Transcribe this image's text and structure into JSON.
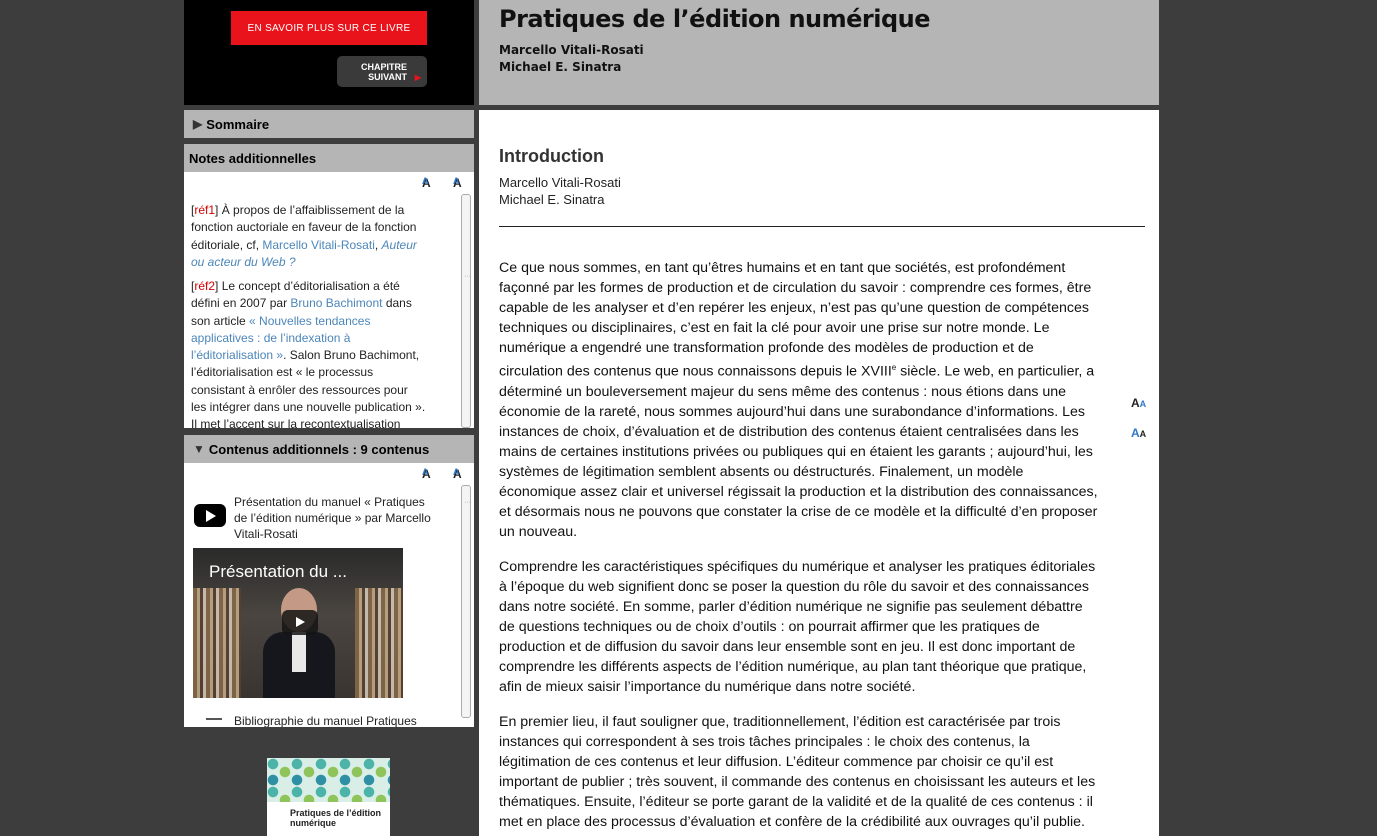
{
  "sidebar": {
    "learn_more_label": "EN SAVOIR PLUS SUR CE LIVRE",
    "next_chapter_line1": "CHAPITRE",
    "next_chapter_line2": "SUIVANT",
    "summary_label": "Sommaire",
    "notes_label": "Notes additionnelles",
    "contents_label": "Contenus additionnels : 9 contenus",
    "text_smaller": "A",
    "text_larger": "A"
  },
  "notes": [
    {
      "ref": "réf1",
      "text_before": " À propos de l’affaiblissement de la fonction auctoriale en faveur de la fonction éditoriale, cf, ",
      "link1": "Marcello Vitali-Rosati",
      "sep": ", ",
      "link2": "Auteur ou acteur du Web ?",
      "text_after": ""
    },
    {
      "ref": "réf2",
      "text_before": " Le concept d’éditorialisation a été défini en 2007 par ",
      "link1": "Bruno Bachimont",
      "mid": " dans son article ",
      "link2": "« Nouvelles tendances applicatives : de l’indexation à l’éditorialisation »",
      "text_after": ". Salon Bruno Bachimont, l’éditorialisation est « le processus consistant à enrôler des ressources pour les intégrer dans une nouvelle publication ». Il met l’accent sur la recontextualisation d’une"
    }
  ],
  "contents": {
    "video_title": "Présentation du manuel « Pratiques de l’édition numérique » par Marcello Vitali-Rosati",
    "video_overlay_title": "Présentation du ...",
    "bibliography_title": "Bibliographie du manuel Pratiques"
  },
  "cover": {
    "title": "Pratiques de l’édition numérique"
  },
  "header": {
    "title": "Pratiques de l’édition numérique",
    "author1": "Marcello Vitali-Rosati",
    "author2": "Michael E. Sinatra"
  },
  "chapter": {
    "title": "Introduction",
    "author1": "Marcello Vitali-Rosati",
    "author2": "Michael E. Sinatra",
    "p1_a": "Ce que nous sommes, en tant qu’êtres humains et en tant que sociétés, est profondément façonné par les formes de production et de circulation du savoir : comprendre ces formes, être capable de les analyser et d’en repérer les enjeux, n’est pas qu’une question de compétences techniques ou disciplinaires, c’est en fait la clé pour avoir une prise sur notre monde. Le numérique a engendré une transformation profonde des modèles de production et de circulation des contenus que nous connaissons depuis le XVIII",
    "p1_sup": "e",
    "p1_b": " siècle. Le web, en particulier, a déterminé un bouleversement majeur du sens même des contenus : nous étions dans une économie de la rareté, nous sommes aujourd’hui dans une surabondance d’informations. Les instances de choix, d’évaluation et de distribution des contenus étaient centralisées dans les mains de certaines institutions privées ou publiques qui en étaient les garants ; aujourd’hui, les systèmes de légitimation semblent absents ou déstructurés. Finalement, un modèle économique assez clair et universel régissait la production et la distribution des connaissances, et désormais nous ne pouvons que constater la crise de ce modèle et la difficulté d’en proposer un nouveau.",
    "p2": "Comprendre les caractéristiques spécifiques du numérique et analyser les pratiques éditoriales à l’époque du web signifient donc se poser la question du rôle du savoir et des connaissances dans notre société. En somme, parler d’édition numérique ne signifie pas seulement débattre de questions techniques ou de choix d’outils : on pourrait affirmer que les pratiques de production et de diffusion du savoir dans leur ensemble sont en jeu. Il est donc important de comprendre les différents aspects de l’édition numérique, au plan tant théorique que pratique, afin de mieux saisir l’importance du numérique dans notre société.",
    "p3": "En premier lieu, il faut souligner que, traditionnellement, l’édition est caractérisée par trois instances qui correspondent à ses trois tâches principales : le choix des contenus, la légitimation de ces contenus et leur diffusion. L’éditeur commence par choisir ce qu’il est important de publier ; très souvent, il commande des contenus en choisissant les auteurs et les thématiques. Ensuite, l’éditeur se porte garant de la validité et de la qualité de ces contenus : il met en place des processus d’évaluation et confère de la crédibilité aux ouvrages qu’il publie. Pour finir, l’éditeur diffuse les contenus et s’occupe de les rendre visibles et"
  }
}
